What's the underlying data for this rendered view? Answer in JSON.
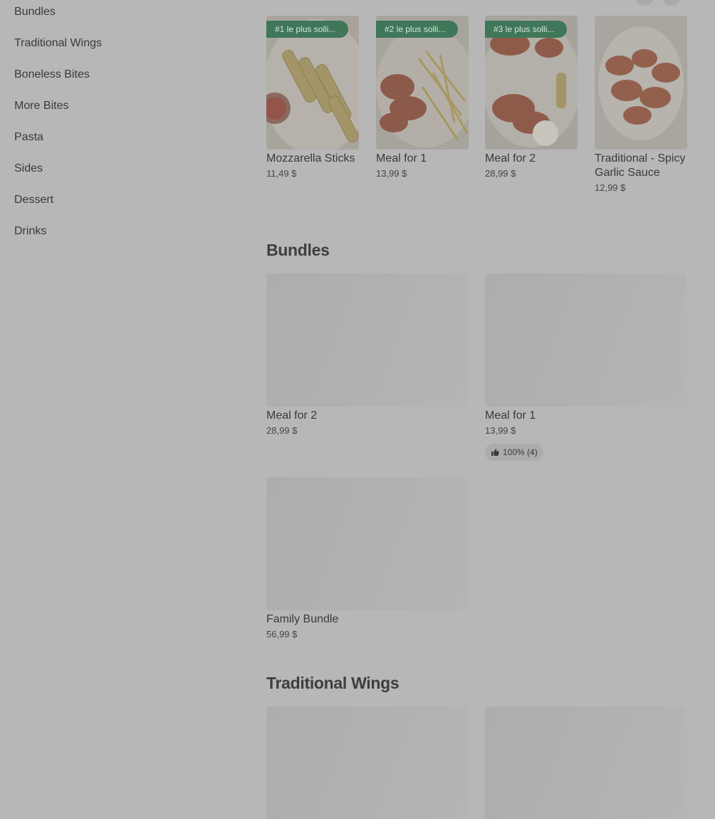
{
  "sidebar": {
    "items": [
      "Bundles",
      "Traditional Wings",
      "Boneless Bites",
      "More Bites",
      "Pasta",
      "Sides",
      "Dessert",
      "Drinks"
    ]
  },
  "popular": {
    "items": [
      {
        "badge": "#1 le plus solli...",
        "title": "Mozzarella Sticks",
        "price": "11,49 $",
        "image": "mozzarella-sticks-photo"
      },
      {
        "badge": "#2 le plus solli...",
        "title": "Meal for 1",
        "price": "13,99 $",
        "image": "wings-and-fries-photo"
      },
      {
        "badge": "#3 le plus solli...",
        "title": "Meal for 2",
        "price": "28,99 $",
        "image": "wings-platter-photo"
      },
      {
        "badge": "",
        "title": "Traditional - Spicy Garlic Sauce",
        "price": "12,99 $",
        "image": "spicy-garlic-wings-photo"
      }
    ]
  },
  "bundles": {
    "title": "Bundles",
    "items": [
      {
        "title": "Meal for 2",
        "price": "28,99 $"
      },
      {
        "title": "Meal for 1",
        "price": "13,99 $",
        "rating": "100% (4)"
      },
      {
        "title": "Family Bundle",
        "price": "56,99 $"
      }
    ]
  },
  "traditional_wings": {
    "title": "Traditional Wings"
  },
  "colors": {
    "overlay_background": "#b7b7b7",
    "badge_green": "#3f7758"
  }
}
